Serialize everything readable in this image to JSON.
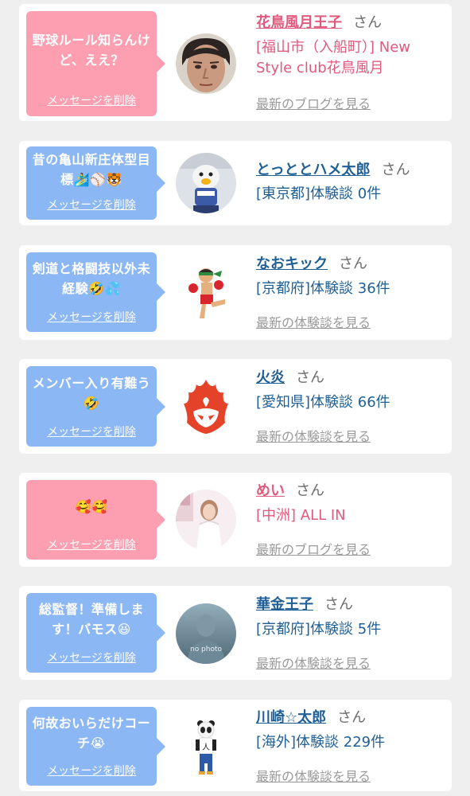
{
  "suffix": "さん",
  "delete_label": "メッセージを削除",
  "colors": {
    "pink_bubble": "#fd9fb1",
    "blue_bubble": "#8cb7f5",
    "pink_text": "#e05a7d",
    "blue_text": "#1f5f95",
    "muted_link": "#9a9a9a",
    "background": "#efefef"
  },
  "entries": [
    {
      "message": "野球ルール知らんけど、ええ？",
      "bubble_color": "pink",
      "avatar": "man-face-photo",
      "name": "花鳥風月王子",
      "desc": "[福山市（入船町）] New Style club花鳥風月",
      "link": "最新のブログを見る"
    },
    {
      "message": "昔の亀山新庄体型目標🏄‍♂️⚾🐯",
      "bubble_color": "blue",
      "avatar": "penguin-mascot-photo",
      "name": "とっととハメ太郎",
      "desc": "[東京都]体験談 0件",
      "link": ""
    },
    {
      "message": "剣道と格闘技以外未経験🤣💦",
      "bubble_color": "blue",
      "avatar": "kickboxer-illustration",
      "name": "なおキック",
      "desc": "[京都府]体験談 36件",
      "link": "最新の体験談を見る"
    },
    {
      "message": "メンバー入り有難う🤣",
      "bubble_color": "blue",
      "avatar": "flame-emblem",
      "name": "火炎",
      "desc": "[愛知県]体験談 66件",
      "link": "最新の体験談を見る"
    },
    {
      "message": "🥰🥰",
      "bubble_color": "pink",
      "avatar": "woman-photo",
      "name": "めい",
      "desc": "[中洲] ALL IN",
      "link": "最新のブログを見る"
    },
    {
      "message": "総監督！準備します！バモス😆",
      "bubble_color": "blue",
      "avatar": "no-photo-placeholder",
      "avatar_text": "no photo",
      "name": "華金王子",
      "desc": "[京都府]体験談 5件",
      "link": "最新の体験談を見る"
    },
    {
      "message": "何故おいらだけコーチ😭",
      "bubble_color": "blue",
      "avatar": "panda-figure",
      "name": "川崎☆太郎",
      "desc": "[海外]体験談 229件",
      "link": "最新の体験談を見る"
    }
  ]
}
